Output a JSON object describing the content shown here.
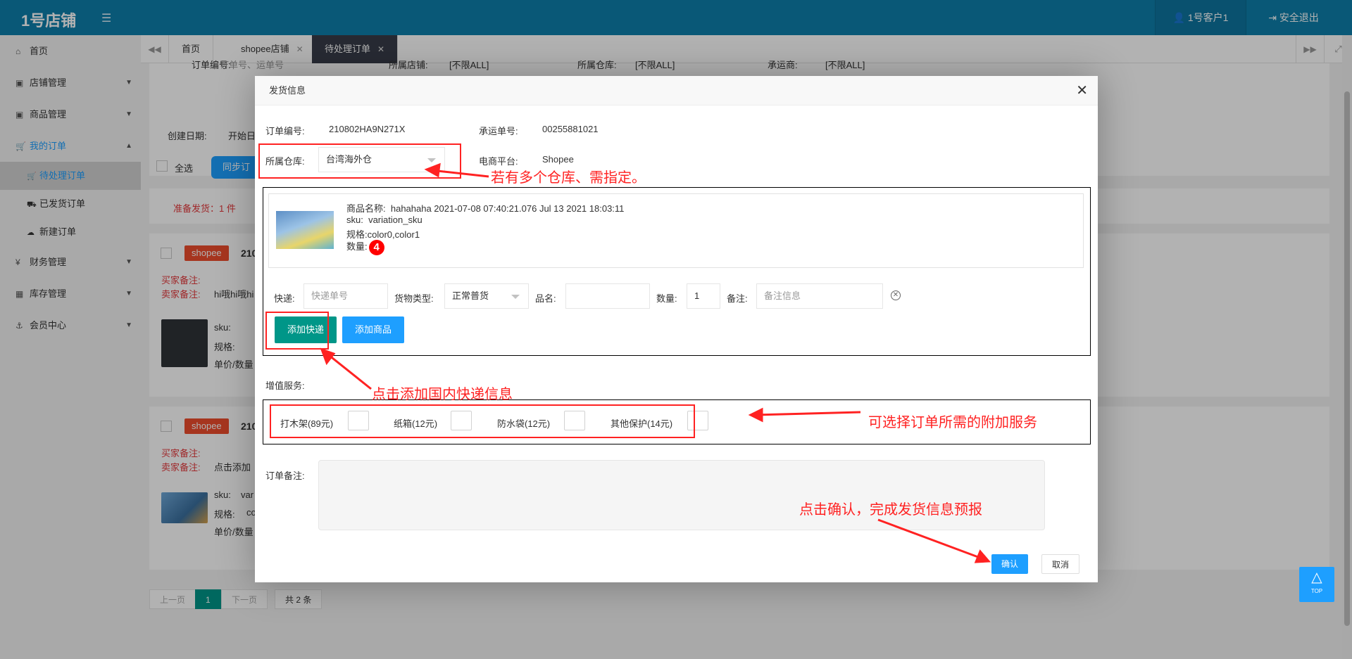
{
  "header": {
    "logo": "1号店铺",
    "menu_icon": "hamburger-icon",
    "user_label": "1号客户1",
    "logout_label": "安全退出"
  },
  "sidebar": {
    "items": [
      {
        "label": "首页",
        "icon": "home-icon"
      },
      {
        "label": "店铺管理",
        "icon": "bag-icon"
      },
      {
        "label": "商品管理",
        "icon": "bag-icon"
      },
      {
        "label": "我的订单",
        "icon": "cart-icon"
      },
      {
        "label": "财务管理",
        "icon": "yen-icon"
      },
      {
        "label": "库存管理",
        "icon": "grid-icon"
      },
      {
        "label": "会员中心",
        "icon": "anchor-icon"
      }
    ],
    "order_sub": [
      {
        "label": "待处理订单",
        "icon": "cart-icon"
      },
      {
        "label": "已发货订单",
        "icon": "truck-icon"
      },
      {
        "label": "新建订单",
        "icon": "cloud-icon"
      }
    ]
  },
  "tabs": [
    {
      "label": "首页"
    },
    {
      "label": "shopee店铺"
    },
    {
      "label": "待处理订单"
    }
  ],
  "background": {
    "filter_order_label": "订单编号:",
    "filter_order_placeholder": "订单号、运单号",
    "filter_shop_label": "所属店铺:",
    "filter_shop_value": "[不限ALL]",
    "filter_wh_label": "所属仓库:",
    "filter_wh_value": "[不限ALL]",
    "filter_carrier_label": "承运商:",
    "filter_carrier_value": "[不限ALL]",
    "created_label": "创建日期:",
    "created_placeholder": "开始日",
    "select_all": "全选",
    "sync_btn": "同步订",
    "ready_text": "准备发货：1 件",
    "order1": {
      "badge": "shopee",
      "no": "210",
      "buyer": "买家备注:",
      "seller": "卖家备注:",
      "seller_val": "hi哦hi哦hi",
      "sku": "sku:",
      "spec": "规格:",
      "price": "单价/数量"
    },
    "order2": {
      "badge": "shopee",
      "no": "210",
      "buyer": "买家备注:",
      "seller": "卖家备注:",
      "seller_val": "点击添加",
      "sku": "sku:",
      "sku_val": "var",
      "spec": "规格:",
      "spec_val": "co",
      "price": "单价/数量"
    },
    "pager": {
      "prev": "上一页",
      "cur": "1",
      "next": "下一页",
      "total": "共 2 条"
    }
  },
  "modal": {
    "title": "发货信息",
    "order_no_label": "订单编号:",
    "order_no": "210802HA9N271X",
    "tracking_label": "承运单号:",
    "tracking": "00255881021",
    "warehouse_label": "所属仓库:",
    "warehouse": "台湾海外仓",
    "platform_label": "电商平台:",
    "platform": "Shopee",
    "product": {
      "name_label": "商品名称:",
      "name": "hahahaha 2021-07-08 07:40:21.076 Jul 13 2021 18:03:11",
      "sku_label": "sku:",
      "sku": "variation_sku",
      "spec_label": "规格:",
      "spec": "color0,color1",
      "qty_label": "数量:",
      "qty": "4"
    },
    "express": {
      "label": "快递:",
      "placeholder": "快递单号",
      "cargo_label": "货物类型:",
      "cargo": "正常普货",
      "name_label": "品名:",
      "qty_label": "数量:",
      "qty": "1",
      "remark_label": "备注:",
      "remark_placeholder": "备注信息"
    },
    "add_express": "添加快递",
    "add_product": "添加商品",
    "vas_label": "增值服务:",
    "services": [
      {
        "label": "打木架(89元)"
      },
      {
        "label": "纸箱(12元)"
      },
      {
        "label": "防水袋(12元)"
      },
      {
        "label": "其他保护(14元)"
      }
    ],
    "remark_label": "订单备注:",
    "confirm": "确认",
    "cancel": "取消"
  },
  "annotations": {
    "warehouse_tip": "若有多个仓库、需指定。",
    "express_tip": "点击添加国内快递信息",
    "service_tip": "可选择订单所需的附加服务",
    "confirm_tip": "点击确认，完成发货信息预报"
  },
  "top_button": "TOP"
}
